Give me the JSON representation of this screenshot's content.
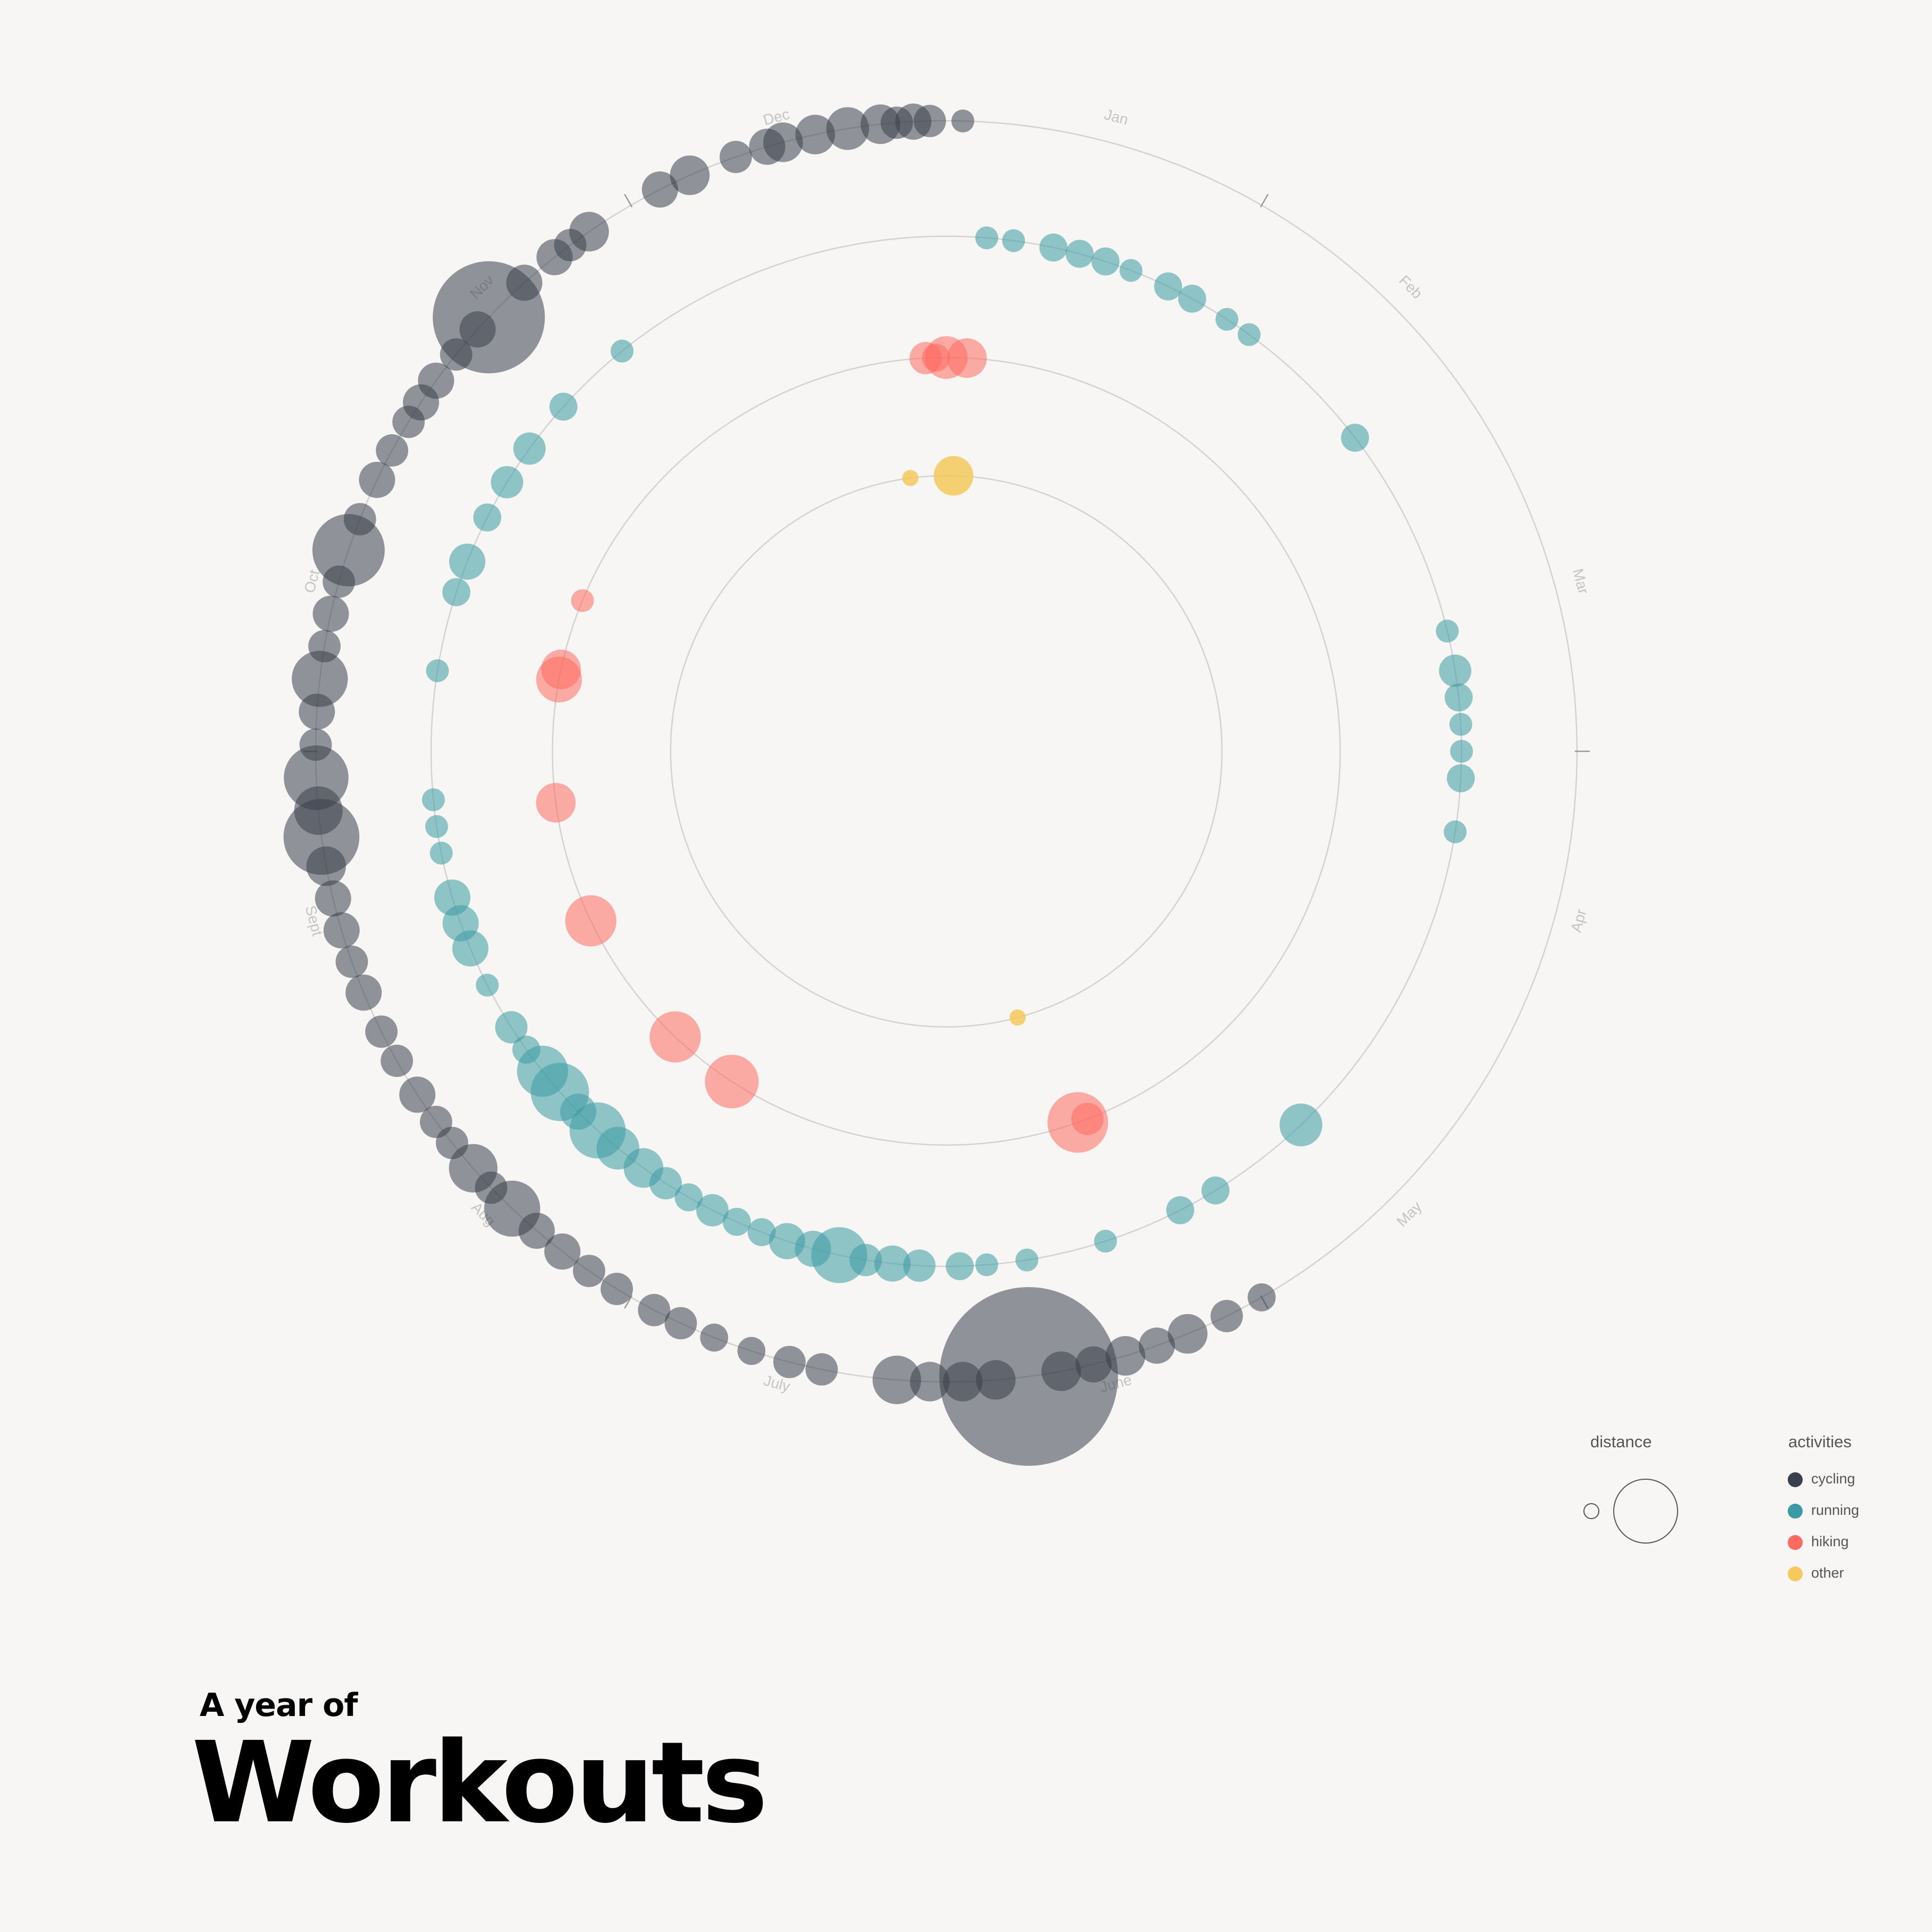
{
  "title_block": {
    "subtitle": "A year of",
    "title": "Workouts"
  },
  "legend": {
    "distance_title": "distance",
    "activities_title": "activities",
    "items": [
      {
        "key": "cycling",
        "label": "cycling",
        "color": "#3a3f4d"
      },
      {
        "key": "running",
        "label": "running",
        "color": "#3b9aa3"
      },
      {
        "key": "hiking",
        "label": "hiking",
        "color": "#ff6a60"
      },
      {
        "key": "other",
        "label": "other",
        "color": "#f5c95c"
      }
    ]
  },
  "chart_data": {
    "type": "scatter",
    "title": "A year of Workouts",
    "layout": "radial",
    "angular_axis": "month",
    "month_labels": [
      "Jan",
      "Feb",
      "Mar",
      "Apr",
      "May",
      "June",
      "July",
      "Aug",
      "Sept",
      "Oct",
      "Nov",
      "Dec"
    ],
    "rings": [
      "other",
      "hiking",
      "running",
      "cycling"
    ],
    "size_encodes": "distance",
    "size_units": "relative",
    "series": [
      {
        "name": "cycling",
        "color": "#3a3f4d",
        "points": [
          {
            "month": 0.05,
            "distance": 2
          },
          {
            "month": 11.95,
            "distance": 4
          },
          {
            "month": 11.9,
            "distance": 5
          },
          {
            "month": 11.85,
            "distance": 4
          },
          {
            "month": 11.8,
            "distance": 6
          },
          {
            "month": 11.7,
            "distance": 7
          },
          {
            "month": 11.6,
            "distance": 6
          },
          {
            "month": 11.5,
            "distance": 6
          },
          {
            "month": 11.45,
            "distance": 5
          },
          {
            "month": 11.35,
            "distance": 4
          },
          {
            "month": 11.2,
            "distance": 6
          },
          {
            "month": 11.1,
            "distance": 5
          },
          {
            "month": 10.85,
            "distance": 6
          },
          {
            "month": 10.78,
            "distance": 4
          },
          {
            "month": 10.72,
            "distance": 5
          },
          {
            "month": 10.6,
            "distance": 5
          },
          {
            "month": 10.45,
            "distance": 48
          },
          {
            "month": 10.4,
            "distance": 5
          },
          {
            "month": 10.3,
            "distance": 4
          },
          {
            "month": 10.2,
            "distance": 5
          },
          {
            "month": 10.12,
            "distance": 5
          },
          {
            "month": 10.05,
            "distance": 4
          },
          {
            "month": 9.95,
            "distance": 4
          },
          {
            "month": 9.85,
            "distance": 5
          },
          {
            "month": 9.72,
            "distance": 4
          },
          {
            "month": 9.62,
            "distance": 20
          },
          {
            "month": 9.52,
            "distance": 4
          },
          {
            "month": 9.42,
            "distance": 5
          },
          {
            "month": 9.32,
            "distance": 4
          },
          {
            "month": 9.22,
            "distance": 12
          },
          {
            "month": 9.12,
            "distance": 5
          },
          {
            "month": 9.02,
            "distance": 4
          },
          {
            "month": 8.92,
            "distance": 16
          },
          {
            "month": 8.82,
            "distance": 9
          },
          {
            "month": 8.74,
            "distance": 22
          },
          {
            "month": 8.65,
            "distance": 6
          },
          {
            "month": 8.55,
            "distance": 5
          },
          {
            "month": 8.45,
            "distance": 5
          },
          {
            "month": 8.35,
            "distance": 4
          },
          {
            "month": 8.25,
            "distance": 5
          },
          {
            "month": 8.12,
            "distance": 4
          },
          {
            "month": 8.02,
            "distance": 4
          },
          {
            "month": 7.9,
            "distance": 5
          },
          {
            "month": 7.8,
            "distance": 4
          },
          {
            "month": 7.72,
            "distance": 4
          },
          {
            "month": 7.62,
            "distance": 9
          },
          {
            "month": 7.54,
            "distance": 4
          },
          {
            "month": 7.45,
            "distance": 12
          },
          {
            "month": 7.35,
            "distance": 5
          },
          {
            "month": 7.25,
            "distance": 5
          },
          {
            "month": 7.15,
            "distance": 4
          },
          {
            "month": 7.05,
            "distance": 4
          },
          {
            "month": 6.92,
            "distance": 4
          },
          {
            "month": 6.83,
            "distance": 4
          },
          {
            "month": 6.72,
            "distance": 3
          },
          {
            "month": 6.6,
            "distance": 3
          },
          {
            "month": 6.48,
            "distance": 4
          },
          {
            "month": 6.38,
            "distance": 4
          },
          {
            "month": 6.15,
            "distance": 9
          },
          {
            "month": 6.05,
            "distance": 6
          },
          {
            "month": 5.95,
            "distance": 6
          },
          {
            "month": 5.85,
            "distance": 6
          },
          {
            "month": 5.75,
            "distance": 122
          },
          {
            "month": 5.65,
            "distance": 6
          },
          {
            "month": 5.55,
            "distance": 5
          },
          {
            "month": 5.45,
            "distance": 6
          },
          {
            "month": 5.35,
            "distance": 5
          },
          {
            "month": 5.25,
            "distance": 6
          },
          {
            "month": 5.12,
            "distance": 4
          },
          {
            "month": 5.0,
            "distance": 3
          }
        ]
      },
      {
        "name": "running",
        "color": "#3b9aa3",
        "points": [
          {
            "month": 0.15,
            "distance": 2
          },
          {
            "month": 0.25,
            "distance": 2
          },
          {
            "month": 0.4,
            "distance": 3
          },
          {
            "month": 0.5,
            "distance": 3
          },
          {
            "month": 0.6,
            "distance": 3
          },
          {
            "month": 0.7,
            "distance": 2
          },
          {
            "month": 0.85,
            "distance": 3
          },
          {
            "month": 0.95,
            "distance": 3
          },
          {
            "month": 1.1,
            "distance": 2
          },
          {
            "month": 1.2,
            "distance": 2
          },
          {
            "month": 1.75,
            "distance": 3
          },
          {
            "month": 2.55,
            "distance": 2
          },
          {
            "month": 2.7,
            "distance": 4
          },
          {
            "month": 2.8,
            "distance": 3
          },
          {
            "month": 2.9,
            "distance": 2
          },
          {
            "month": 3.0,
            "distance": 2
          },
          {
            "month": 3.1,
            "distance": 3
          },
          {
            "month": 3.3,
            "distance": 2
          },
          {
            "month": 4.55,
            "distance": 7
          },
          {
            "month": 4.95,
            "distance": 3
          },
          {
            "month": 5.1,
            "distance": 3
          },
          {
            "month": 5.4,
            "distance": 2
          },
          {
            "month": 5.7,
            "distance": 2
          },
          {
            "month": 5.85,
            "distance": 2
          },
          {
            "month": 5.95,
            "distance": 3
          },
          {
            "month": 6.1,
            "distance": 4
          },
          {
            "month": 6.2,
            "distance": 5
          },
          {
            "month": 6.3,
            "distance": 4
          },
          {
            "month": 6.4,
            "distance": 12
          },
          {
            "month": 6.5,
            "distance": 5
          },
          {
            "month": 6.6,
            "distance": 5
          },
          {
            "month": 6.7,
            "distance": 3
          },
          {
            "month": 6.8,
            "distance": 3
          },
          {
            "month": 6.9,
            "distance": 4
          },
          {
            "month": 7.0,
            "distance": 3
          },
          {
            "month": 7.1,
            "distance": 4
          },
          {
            "month": 7.2,
            "distance": 6
          },
          {
            "month": 7.32,
            "distance": 7
          },
          {
            "month": 7.42,
            "distance": 12
          },
          {
            "month": 7.52,
            "distance": 5
          },
          {
            "month": 7.62,
            "distance": 13
          },
          {
            "month": 7.72,
            "distance": 10
          },
          {
            "month": 7.82,
            "distance": 3
          },
          {
            "month": 7.92,
            "distance": 4
          },
          {
            "month": 8.1,
            "distance": 2
          },
          {
            "month": 8.25,
            "distance": 5
          },
          {
            "month": 8.35,
            "distance": 5
          },
          {
            "month": 8.45,
            "distance": 5
          },
          {
            "month": 8.62,
            "distance": 2
          },
          {
            "month": 8.72,
            "distance": 2
          },
          {
            "month": 8.82,
            "distance": 2
          },
          {
            "month": 9.3,
            "distance": 2
          },
          {
            "month": 9.6,
            "distance": 3
          },
          {
            "month": 9.72,
            "distance": 5
          },
          {
            "month": 9.9,
            "distance": 3
          },
          {
            "month": 10.05,
            "distance": 4
          },
          {
            "month": 10.2,
            "distance": 4
          },
          {
            "month": 10.4,
            "distance": 3
          },
          {
            "month": 10.7,
            "distance": 2
          }
        ]
      },
      {
        "name": "hiking",
        "color": "#ff6a60",
        "points": [
          {
            "month": 11.95,
            "distance": 3
          },
          {
            "month": 0.0,
            "distance": 7
          },
          {
            "month": 0.1,
            "distance": 6
          },
          {
            "month": 11.9,
            "distance": 4
          },
          {
            "month": 5.35,
            "distance": 14
          },
          {
            "month": 5.3,
            "distance": 4
          },
          {
            "month": 7.1,
            "distance": 11
          },
          {
            "month": 7.45,
            "distance": 10
          },
          {
            "month": 8.15,
            "distance": 10
          },
          {
            "month": 8.75,
            "distance": 6
          },
          {
            "month": 9.35,
            "distance": 8
          },
          {
            "month": 9.4,
            "distance": 6
          },
          {
            "month": 9.75,
            "distance": 2
          }
        ]
      },
      {
        "name": "other",
        "color": "#f5c95c",
        "points": [
          {
            "month": 0.05,
            "distance": 6
          },
          {
            "month": 11.75,
            "distance": 1
          },
          {
            "month": 5.5,
            "distance": 1
          }
        ]
      }
    ]
  }
}
